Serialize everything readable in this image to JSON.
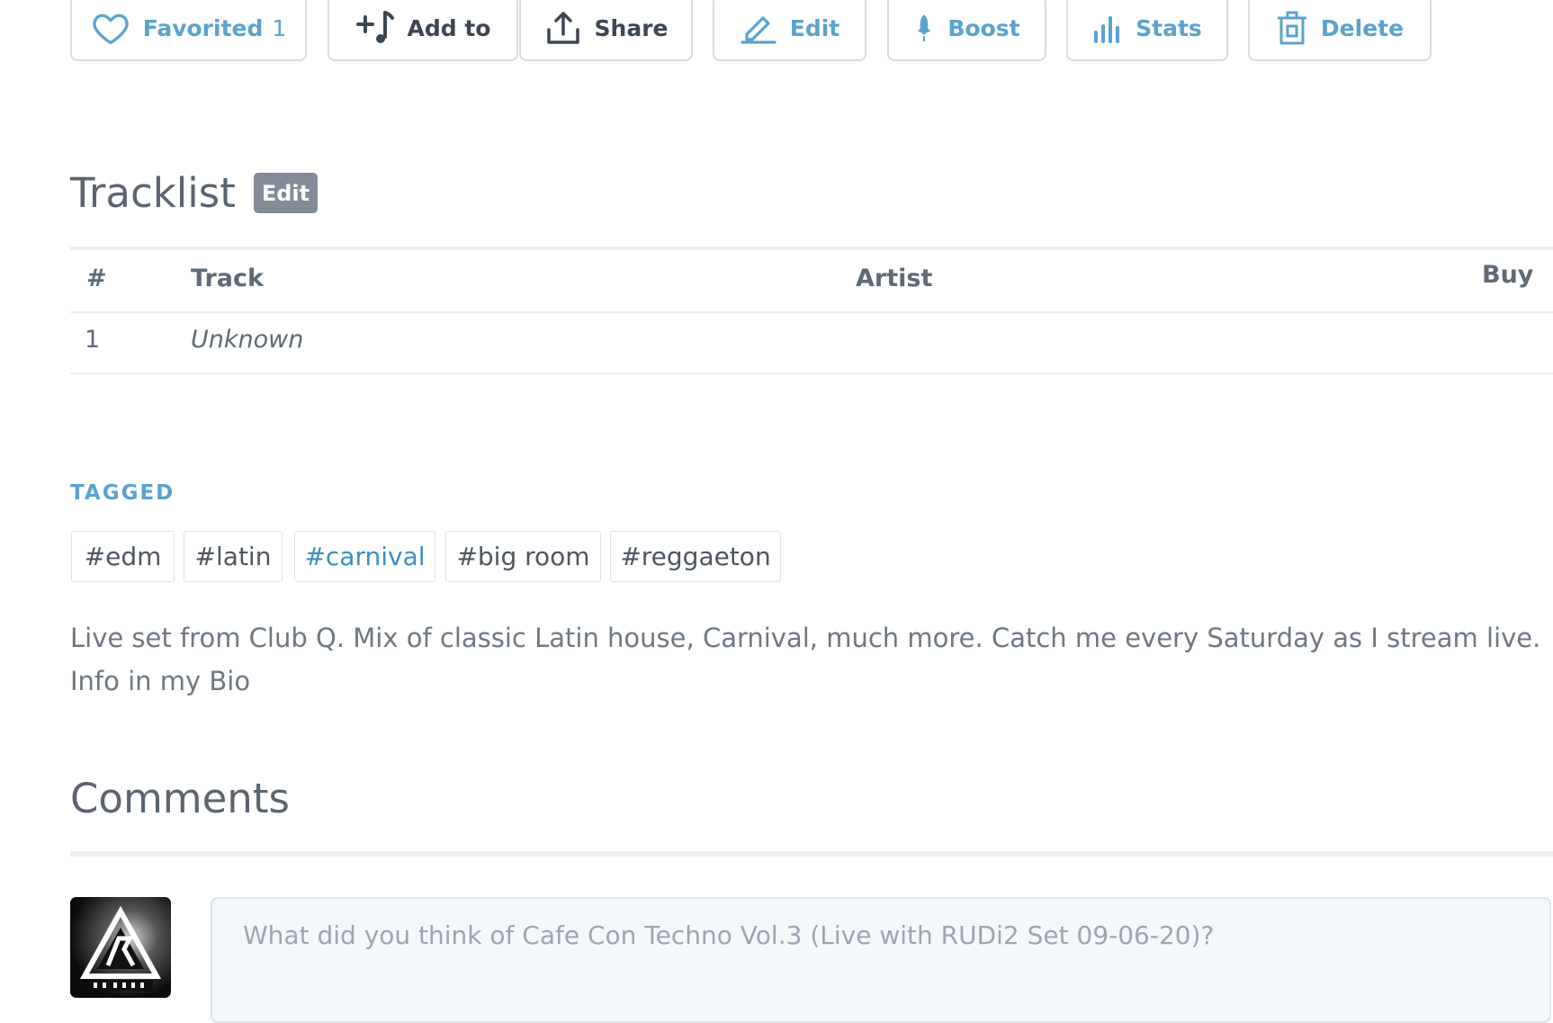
{
  "toolbar": {
    "favorited_label": "Favorited",
    "favorited_count": "1",
    "add_to_label": "Add to",
    "share_label": "Share",
    "edit_label": "Edit",
    "boost_label": "Boost",
    "stats_label": "Stats",
    "delete_label": "Delete"
  },
  "tracklist": {
    "title": "Tracklist",
    "edit_label": "Edit",
    "columns": {
      "num": "#",
      "track": "Track",
      "artist": "Artist",
      "buy": "Buy"
    },
    "rows": [
      {
        "num": "1",
        "track": "Unknown",
        "artist": ""
      }
    ]
  },
  "tags": {
    "label": "TAGGED",
    "items": [
      "#edm",
      "#latin",
      "#carnival",
      "#big room",
      "#reggaeton"
    ]
  },
  "description": "Live set from Club Q. Mix of classic Latin house, Carnival, much more. Catch me every Saturday as I stream live. Info in my Bio",
  "comments": {
    "title": "Comments",
    "placeholder": "What did you think of Cafe Con Techno Vol.3 (Live with RUDi2 Set 09-06-20)?"
  },
  "colors": {
    "accent": "#5aa3cf",
    "tag_active": "#3c8fbf",
    "badge": "#818c98"
  }
}
